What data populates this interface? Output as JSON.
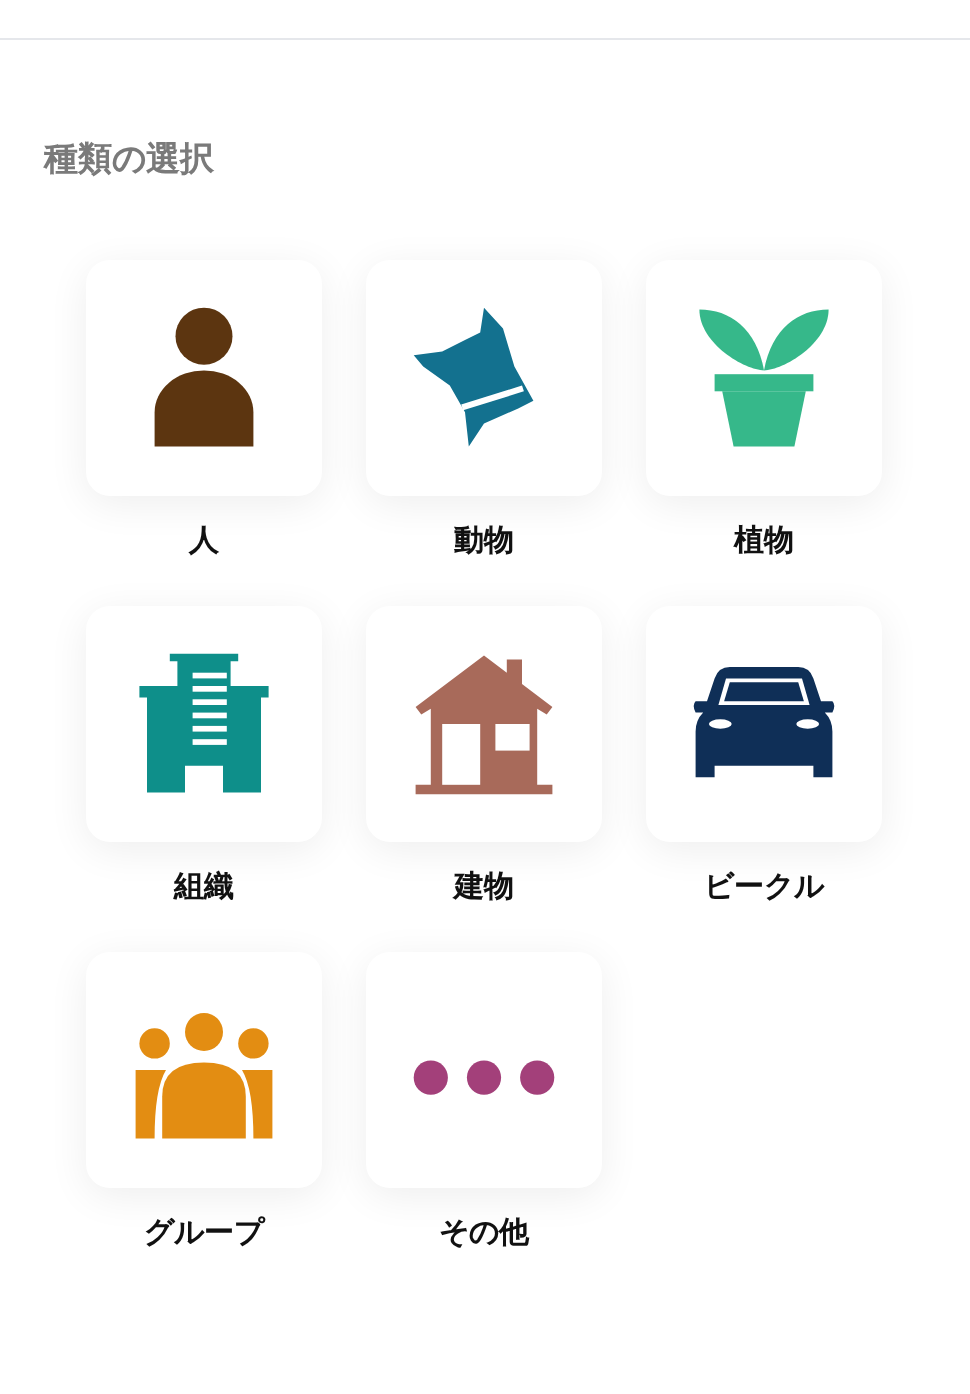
{
  "heading": "種類の選択",
  "items": [
    {
      "label": "人",
      "kind": "person",
      "color": "#5c3510"
    },
    {
      "label": "動物",
      "kind": "dog",
      "color": "#13718f"
    },
    {
      "label": "植物",
      "kind": "plant",
      "color": "#36b88a"
    },
    {
      "label": "組織",
      "kind": "building",
      "color": "#0e8f8a"
    },
    {
      "label": "建物",
      "kind": "house",
      "color": "#a86a5a"
    },
    {
      "label": "ビークル",
      "kind": "car",
      "color": "#0f2f57"
    },
    {
      "label": "グループ",
      "kind": "group",
      "color": "#e38d12"
    },
    {
      "label": "その他",
      "kind": "more",
      "color": "#a3407a"
    }
  ]
}
